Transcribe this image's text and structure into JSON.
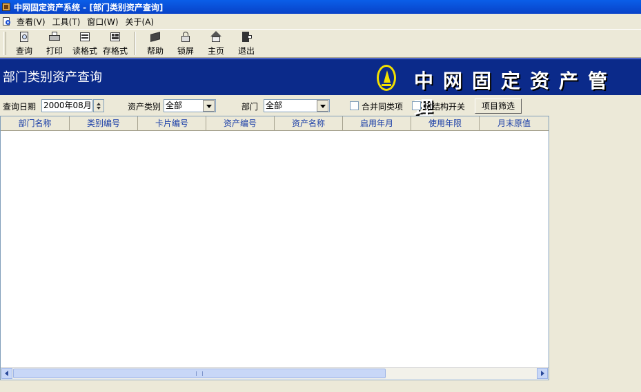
{
  "window": {
    "title": "中网固定资产系统 - [部门类别资产查询]"
  },
  "menu": {
    "items": [
      {
        "label": "查看(V)"
      },
      {
        "label": "工具(T)"
      },
      {
        "label": "窗口(W)"
      },
      {
        "label": "关于(A)"
      }
    ]
  },
  "toolbar": {
    "query": "查询",
    "print": "打印",
    "read_format": "读格式",
    "save_format": "存格式",
    "help": "帮助",
    "lock": "锁屏",
    "home": "主页",
    "exit": "退出"
  },
  "banner": {
    "title": "部门类别资产查询",
    "brand": "中网固定资产管理",
    "brand_color": "#f2e000"
  },
  "filters": {
    "date_label": "查询日期",
    "date_value": "2000年08月",
    "category_label": "资产类别",
    "category_value": "全部",
    "dept_label": "部门",
    "dept_value": "全部",
    "merge_label": "合并同类项",
    "tree_label": "树结构开关",
    "filter_button": "项目筛选"
  },
  "table": {
    "columns": [
      "部门名称",
      "类别编号",
      "卡片编号",
      "资产编号",
      "资产名称",
      "启用年月",
      "使用年限",
      "月末原值"
    ]
  },
  "colors": {
    "title_bar": "#0a5ee8",
    "banner_bg": "#0b2a8a",
    "header_text": "#1b3fa8"
  }
}
